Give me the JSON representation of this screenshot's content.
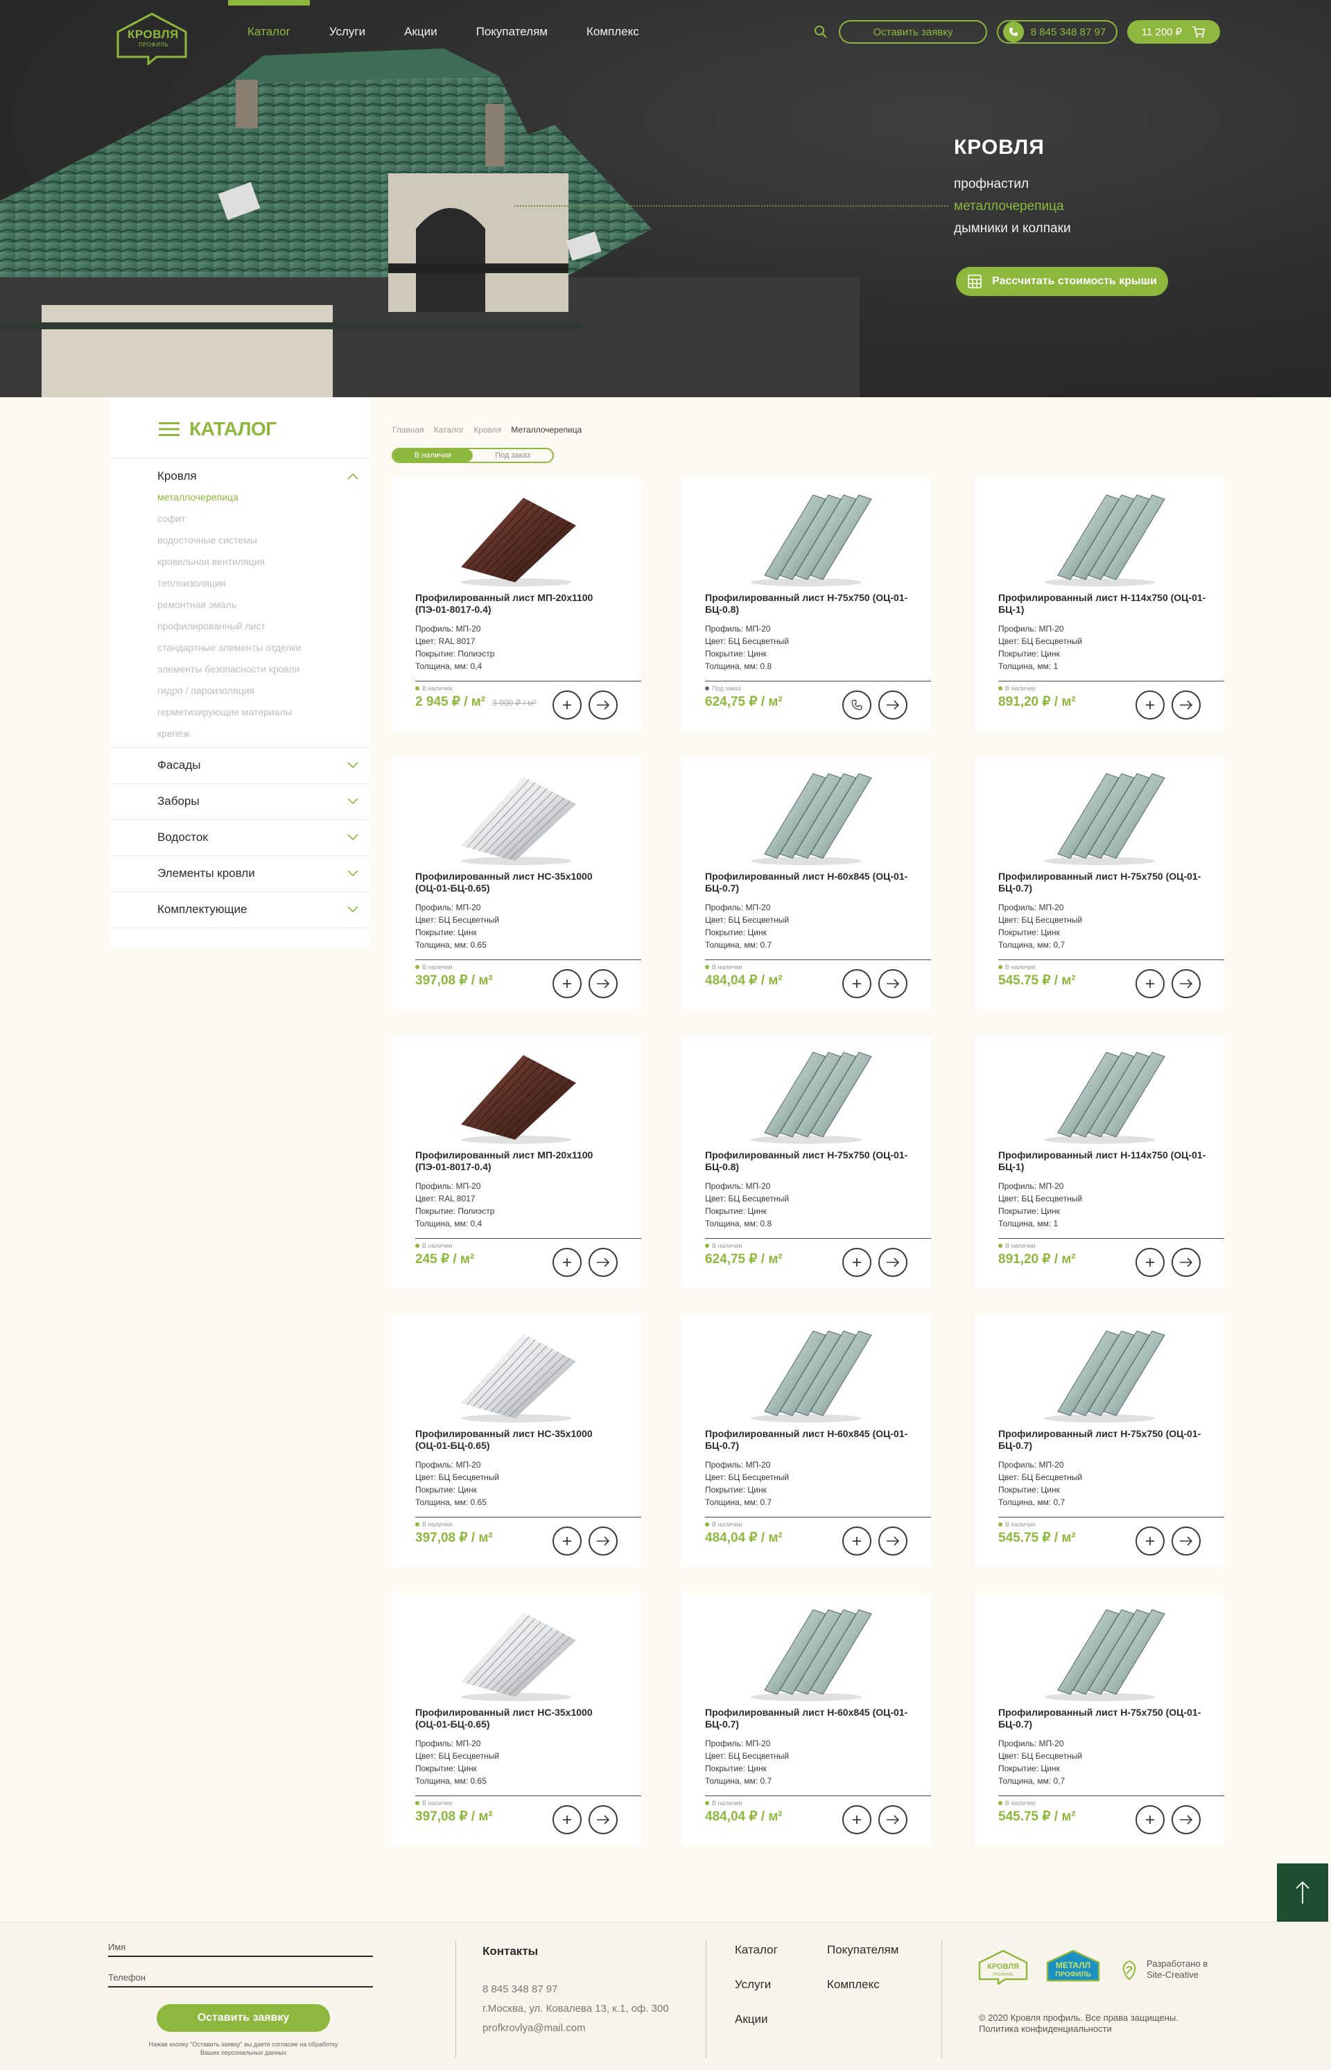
{
  "header": {
    "logo_main": "КРОВЛЯ",
    "logo_sub": "ПРОФИЛЬ",
    "nav": [
      "Каталог",
      "Услуги",
      "Акции",
      "Покупателям",
      "Комплекс"
    ],
    "request_button": "Оставить заявку",
    "phone": "8 845 348 87 97",
    "cart_total": "11 200 ₽"
  },
  "hero": {
    "title": "КРОВЛЯ",
    "items": [
      "профнастил",
      "металлочерепица",
      "дымники и колпаки"
    ],
    "selected_index": 1,
    "cta": "Рассчитать стоимость крыши"
  },
  "sidebar": {
    "title": "КАТАЛОГ",
    "open_category": "Кровля",
    "subitems": [
      "металлочерепица",
      "софит",
      "водосточные системы",
      "кровельная вентиляция",
      "теплоизоляция",
      "ремонтная эмаль",
      "профилированный лист",
      "стандартные элементы отделки",
      "элементы безопасности кровли",
      "гидро / пароизоляция",
      "герметизирующие материалы",
      "крепёж"
    ],
    "selected_subitem": 0,
    "categories": [
      "Фасады",
      "Заборы",
      "Водосток",
      "Элементы кровли",
      "Комплектующие"
    ]
  },
  "breadcrumbs": [
    "Главная",
    "Каталог",
    "Кровля",
    "Металлочерепица"
  ],
  "availability_toggle": {
    "in_stock": "В наличии",
    "on_order": "Под заказ",
    "active": "in_stock"
  },
  "products": [
    {
      "title": "Профилированный лист МП-20х1100 (ПЭ-01-8017-0.4)",
      "specs": [
        "Профиль: МП-20",
        "Цвет: RAL 8017",
        "Покрытие: Полиэстр",
        "Толщина, мм: 0,4"
      ],
      "status": "В наличии",
      "price": "2 945 ₽ / м²",
      "old_price": "3 900 ₽ / м²",
      "image": "brown",
      "action": "plus"
    },
    {
      "title": "Профилированный лист Н-75х750 (ОЦ-01-БЦ-0.8)",
      "specs": [
        "Профиль: МП-20",
        "Цвет: БЦ Бесцветный",
        "Покрытие: Цинк",
        "Толщина, мм: 0.8"
      ],
      "status": "Под заказ",
      "price": "624,75 ₽ / м²",
      "old_price": "",
      "image": "deep",
      "action": "phone"
    },
    {
      "title": "Профилированный лист Н-114х750 (ОЦ-01-БЦ-1)",
      "specs": [
        "Профиль: МП-20",
        "Цвет: БЦ Бесцветный",
        "Покрытие: Цинк",
        "Толщина, мм: 1"
      ],
      "status": "В наличии",
      "price": "891,20 ₽ / м²",
      "old_price": "",
      "image": "deep",
      "action": "plus"
    },
    {
      "title": "Профилированный лист НС-35х1000 (ОЦ-01-БЦ-0.65)",
      "specs": [
        "Профиль: МП-20",
        "Цвет: БЦ Бесцветный",
        "Покрытие: Цинк",
        "Толщина, мм: 0.65"
      ],
      "status": "В наличии",
      "price": "397,08 ₽ / м²",
      "old_price": "",
      "image": "silver",
      "action": "plus"
    },
    {
      "title": "Профилированный лист Н-60х845 (ОЦ-01-БЦ-0.7)",
      "specs": [
        "Профиль: МП-20",
        "Цвет: БЦ Бесцветный",
        "Покрытие: Цинк",
        "Толщина, мм: 0.7"
      ],
      "status": "В наличии",
      "price": "484,04 ₽ / м²",
      "old_price": "",
      "image": "deep",
      "action": "plus"
    },
    {
      "title": "Профилированный лист Н-75х750 (ОЦ-01-БЦ-0.7)",
      "specs": [
        "Профиль: МП-20",
        "Цвет: БЦ Бесцветный",
        "Покрытие: Цинк",
        "Толщина, мм: 0,7"
      ],
      "status": "В наличии",
      "price": "545.75 ₽ / м²",
      "old_price": "",
      "image": "deep",
      "action": "plus"
    },
    {
      "title": "Профилированный лист МП-20х1100 (ПЭ-01-8017-0.4)",
      "specs": [
        "Профиль: МП-20",
        "Цвет: RAL 8017",
        "Покрытие: Полиэстр",
        "Толщина, мм: 0,4"
      ],
      "status": "В наличии",
      "price": "245 ₽ / м²",
      "old_price": "",
      "image": "brown",
      "action": "plus"
    },
    {
      "title": "Профилированный лист Н-75х750 (ОЦ-01-БЦ-0.8)",
      "specs": [
        "Профиль: МП-20",
        "Цвет: БЦ Бесцветный",
        "Покрытие: Цинк",
        "Толщина, мм: 0.8"
      ],
      "status": "В наличии",
      "price": "624,75 ₽ / м²",
      "old_price": "",
      "image": "deep",
      "action": "plus"
    },
    {
      "title": "Профилированный лист Н-114х750 (ОЦ-01-БЦ-1)",
      "specs": [
        "Профиль: МП-20",
        "Цвет: БЦ Бесцветный",
        "Покрытие: Цинк",
        "Толщина, мм: 1"
      ],
      "status": "В наличии",
      "price": "891,20 ₽ / м²",
      "old_price": "",
      "image": "deep",
      "action": "plus"
    },
    {
      "title": "Профилированный лист НС-35х1000 (ОЦ-01-БЦ-0.65)",
      "specs": [
        "Профиль: МП-20",
        "Цвет: БЦ Бесцветный",
        "Покрытие: Цинк",
        "Толщина, мм: 0.65"
      ],
      "status": "В наличии",
      "price": "397,08 ₽ / м²",
      "old_price": "",
      "image": "silver",
      "action": "plus"
    },
    {
      "title": "Профилированный лист Н-60х845 (ОЦ-01-БЦ-0.7)",
      "specs": [
        "Профиль: МП-20",
        "Цвет: БЦ Бесцветный",
        "Покрытие: Цинк",
        "Толщина, мм: 0.7"
      ],
      "status": "В наличии",
      "price": "484,04 ₽ / м²",
      "old_price": "",
      "image": "deep",
      "action": "plus"
    },
    {
      "title": "Профилированный лист Н-75х750 (ОЦ-01-БЦ-0.7)",
      "specs": [
        "Профиль: МП-20",
        "Цвет: БЦ Бесцветный",
        "Покрытие: Цинк",
        "Толщина, мм: 0,7"
      ],
      "status": "В наличии",
      "price": "545.75 ₽ / м²",
      "old_price": "",
      "image": "deep",
      "action": "plus"
    },
    {
      "title": "Профилированный лист НС-35х1000 (ОЦ-01-БЦ-0.65)",
      "specs": [
        "Профиль: МП-20",
        "Цвет: БЦ Бесцветный",
        "Покрытие: Цинк",
        "Толщина, мм: 0.65"
      ],
      "status": "В наличии",
      "price": "397,08 ₽ / м²",
      "old_price": "",
      "image": "silver",
      "action": "plus"
    },
    {
      "title": "Профилированный лист Н-60х845 (ОЦ-01-БЦ-0.7)",
      "specs": [
        "Профиль: МП-20",
        "Цвет: БЦ Бесцветный",
        "Покрытие: Цинк",
        "Толщина, мм: 0.7"
      ],
      "status": "В наличии",
      "price": "484,04 ₽ / м²",
      "old_price": "",
      "image": "deep",
      "action": "plus"
    },
    {
      "title": "Профилированный лист Н-75х750 (ОЦ-01-БЦ-0.7)",
      "specs": [
        "Профиль: МП-20",
        "Цвет: БЦ Бесцветный",
        "Покрытие: Цинк",
        "Толщина, мм: 0,7"
      ],
      "status": "В наличии",
      "price": "545.75 ₽ / м²",
      "old_price": "",
      "image": "deep",
      "action": "plus"
    }
  ],
  "footer": {
    "name_label": "Имя",
    "phone_label": "Телефон",
    "submit": "Оставить заявку",
    "note": "Нажав кнопку \"Оставить заявку\" вы даете согласие на обработку Ваших персональных данных",
    "contacts_title": "Контакты",
    "phone": "8 845 348 87 97",
    "address": "г.Москва, ул. Ковалева 13, к.1, оф. 300",
    "email": "profkrovlya@mail.com",
    "menu": [
      "Каталог",
      "Покупателям",
      "Услуги",
      "Комплекс",
      "Акции"
    ],
    "badge1": [
      "КРОВЛЯ",
      "ПРОФИЛЬ"
    ],
    "badge2": [
      "МЕТАЛЛ",
      "ПРОФИЛЬ"
    ],
    "developer": [
      "Разработано в",
      "Site-Creative"
    ],
    "copyright": "© 2020 Кровля профиль. Все права защищены.",
    "privacy": "Политика конфиденциальности"
  },
  "colors": {
    "accent": "#8db83d",
    "dark": "#2c2c2c",
    "page_bg": "#fdf9f3",
    "scroll_top": "#1f4d2f"
  }
}
